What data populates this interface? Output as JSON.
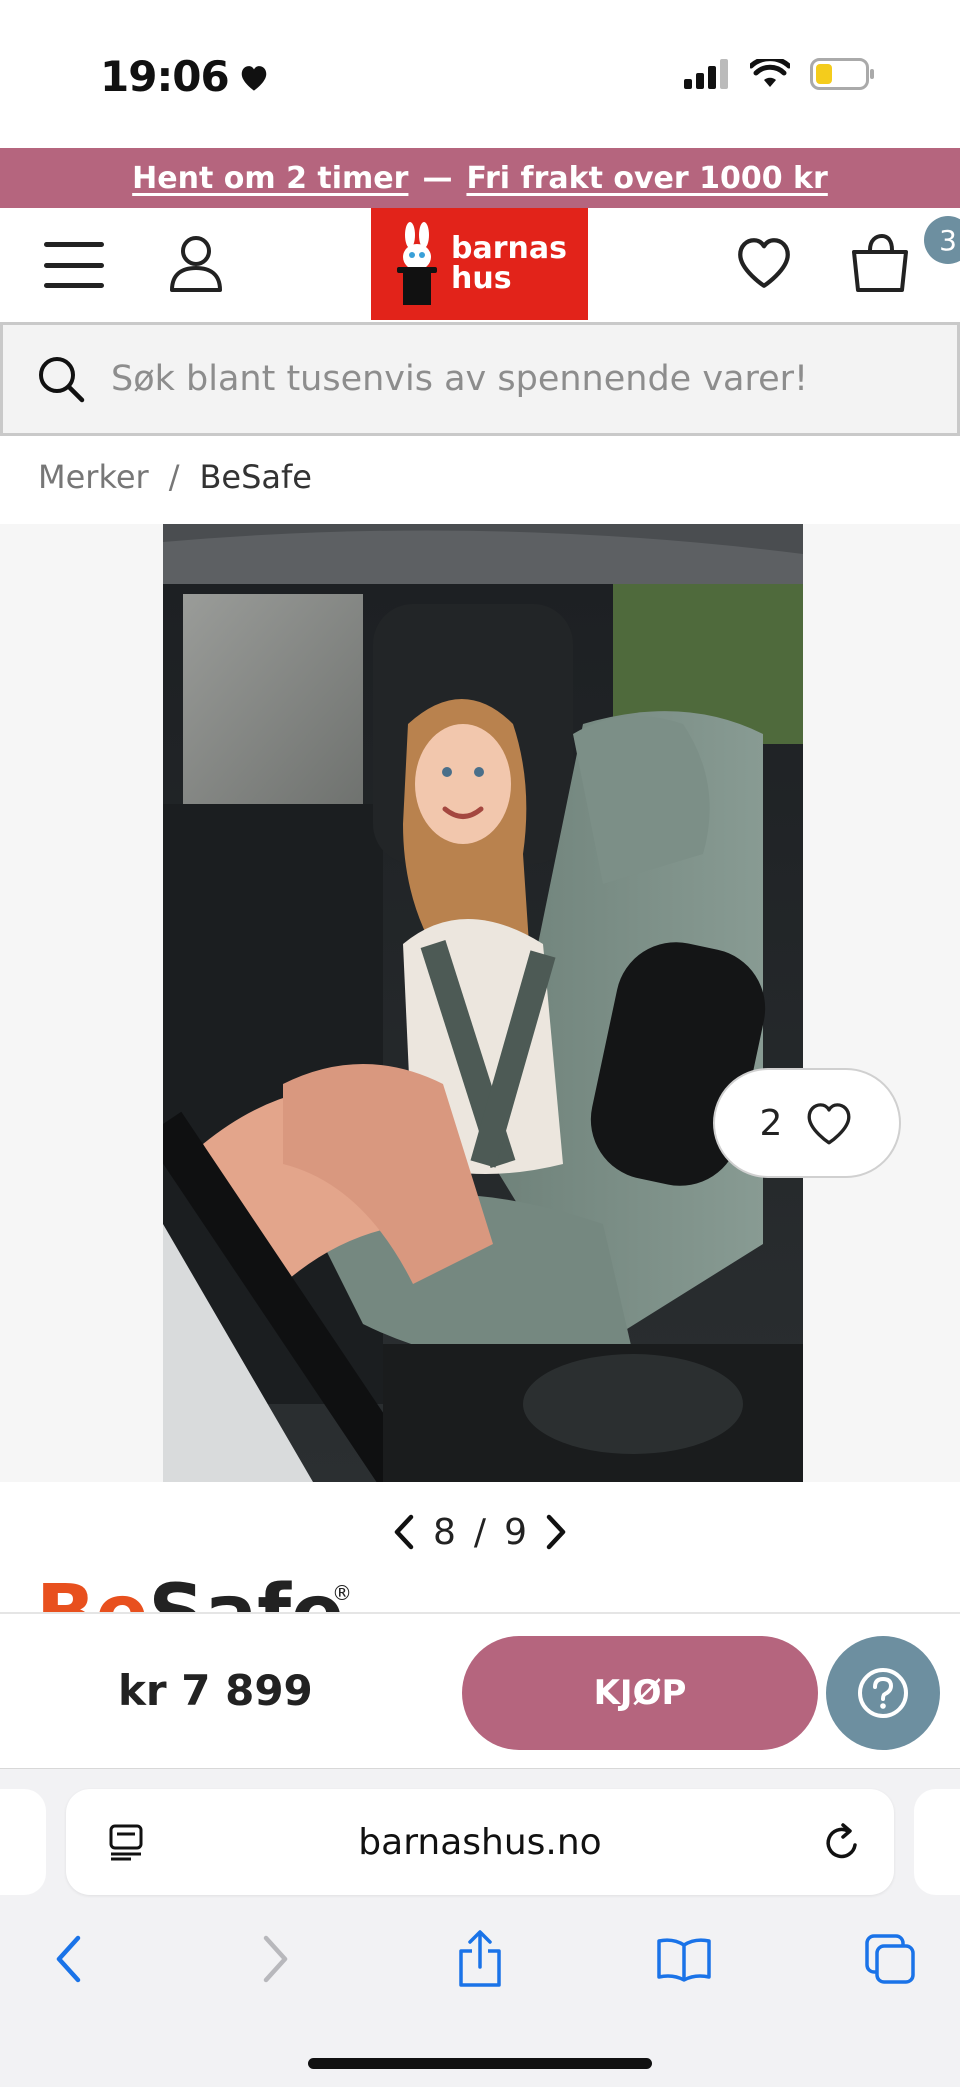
{
  "status_bar": {
    "time": "19:06"
  },
  "promo": {
    "left_link": "Hent om 2 timer",
    "separator": "—",
    "right_link": "Fri frakt over 1000 kr"
  },
  "header": {
    "logo_line1": "barnas",
    "logo_line2": "hus",
    "cart_count": "3"
  },
  "search": {
    "placeholder": "Søk blant tusenvis av spennende varer!"
  },
  "breadcrumb": {
    "items": [
      "Merker",
      "BeSafe"
    ],
    "separator": "/"
  },
  "product": {
    "like_count": "2",
    "pager_current": "8",
    "pager_sep": "/",
    "pager_total": "9",
    "brand": "BeSafe",
    "price": "kr 7 899",
    "buy_label": "KJØP"
  },
  "browser": {
    "url": "barnashus.no"
  },
  "colors": {
    "accent": "#b5657e",
    "logo_red": "#e2231a",
    "badge": "#6d8fa0",
    "ios_blue": "#1a73e8"
  }
}
